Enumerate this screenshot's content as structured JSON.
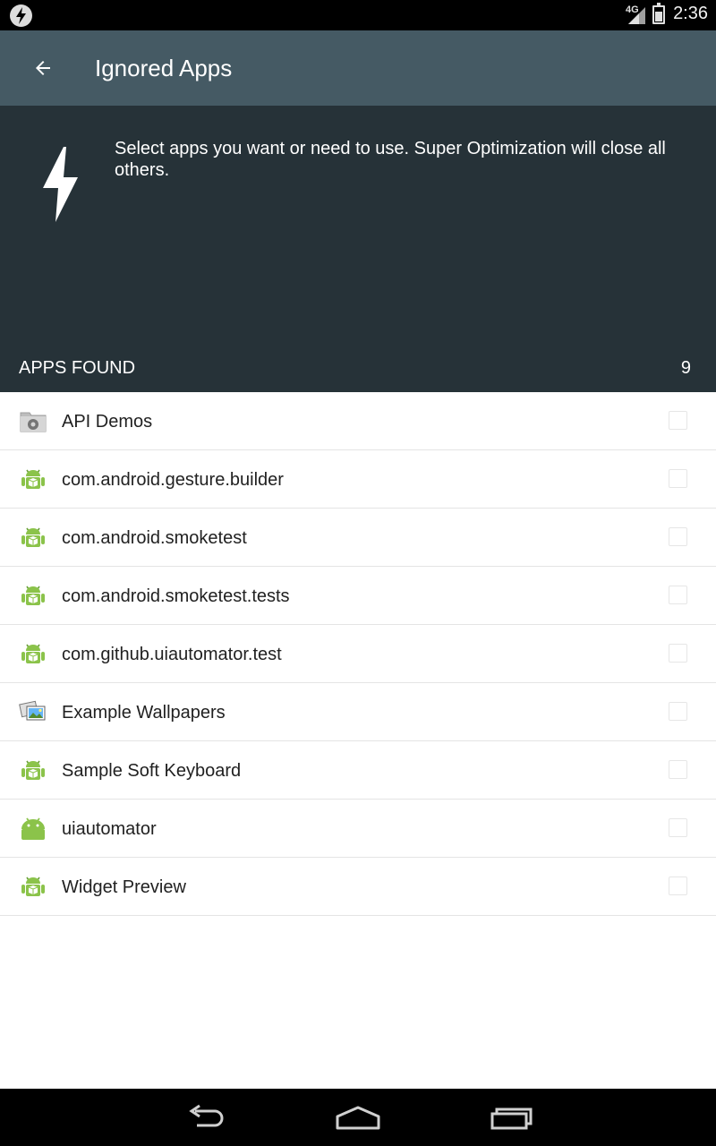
{
  "status_bar": {
    "network": "4G",
    "time": "2:36"
  },
  "toolbar": {
    "title": "Ignored Apps"
  },
  "header": {
    "description": "Select apps you want or need to use. Super Optimization will close all others.",
    "apps_found_label": "APPS FOUND",
    "apps_found_count": "9"
  },
  "apps": [
    {
      "label": "API Demos",
      "icon": "settings-folder-icon",
      "checked": false
    },
    {
      "label": "com.android.gesture.builder",
      "icon": "android-package-icon",
      "checked": false
    },
    {
      "label": "com.android.smoketest",
      "icon": "android-package-icon",
      "checked": false
    },
    {
      "label": "com.android.smoketest.tests",
      "icon": "android-package-icon",
      "checked": false
    },
    {
      "label": "com.github.uiautomator.test",
      "icon": "android-package-icon",
      "checked": false
    },
    {
      "label": "Example Wallpapers",
      "icon": "wallpapers-icon",
      "checked": false
    },
    {
      "label": "Sample Soft Keyboard",
      "icon": "android-package-icon",
      "checked": false
    },
    {
      "label": "uiautomator",
      "icon": "android-head-icon",
      "checked": false
    },
    {
      "label": "Widget Preview",
      "icon": "android-package-icon",
      "checked": false
    }
  ],
  "colors": {
    "toolbar": "#455a64",
    "header": "#263238",
    "android_green": "#8bc34a"
  }
}
